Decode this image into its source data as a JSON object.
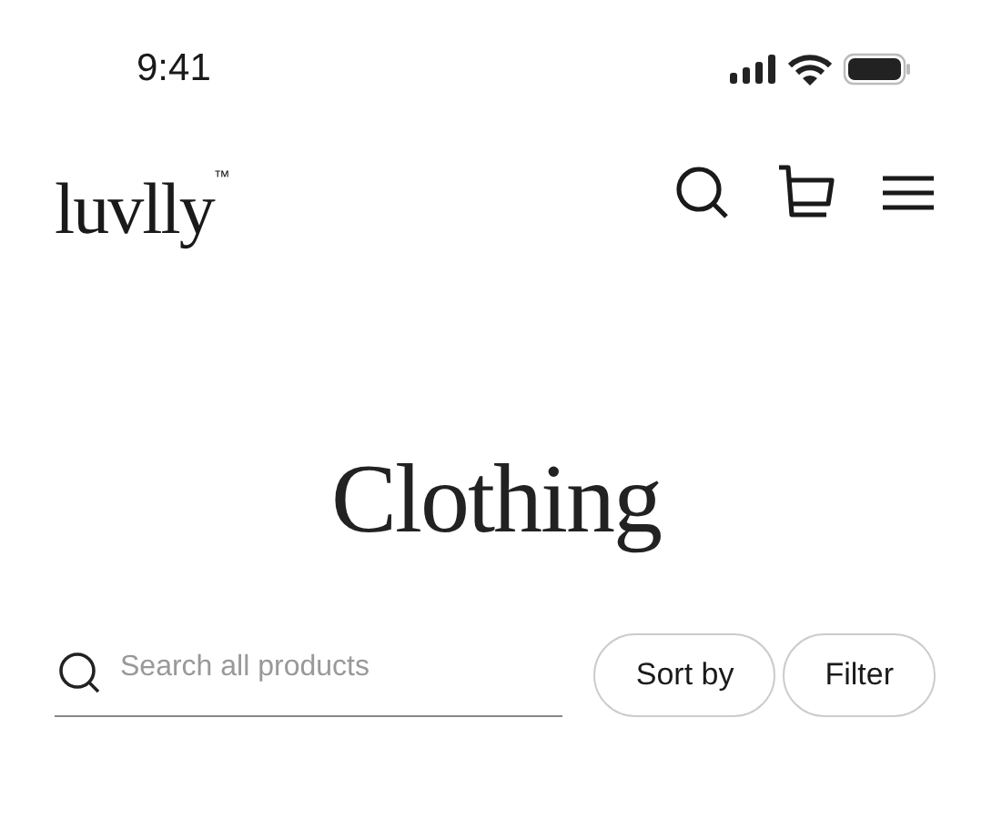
{
  "status_bar": {
    "time": "9:41"
  },
  "header": {
    "logo": "luvlly$^{™}$"
  },
  "title": "Clothing",
  "search": {
    "placeholder": "Search all products"
  },
  "buttons": [
    {
      "label": "Sort by"
    },
    {
      "label": "Filter"
    }
  ]
}
